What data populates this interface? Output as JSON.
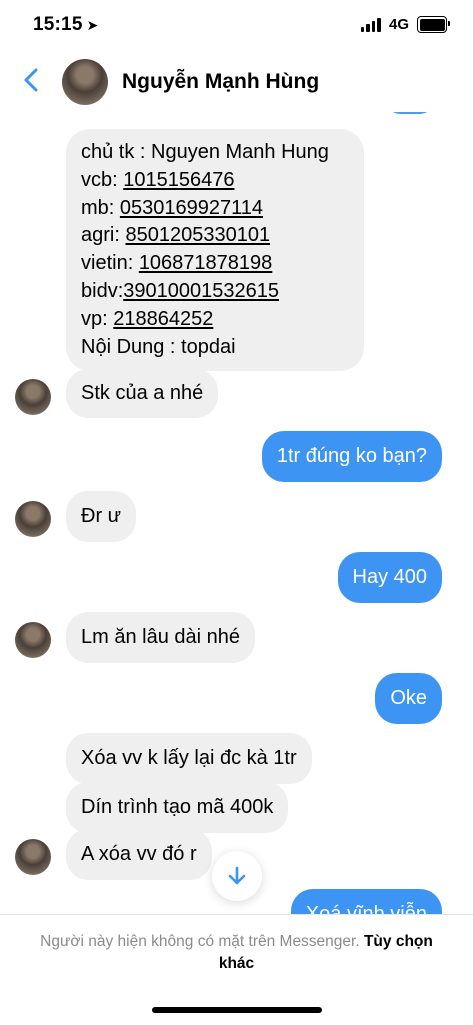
{
  "status": {
    "time": "15:15",
    "network": "4G"
  },
  "header": {
    "contact_name": "Nguyễn Mạnh Hùng"
  },
  "messages": {
    "account_info": [
      {
        "label": "chủ tk : Nguyen Manh Hung",
        "link": ""
      },
      {
        "label": "vcb: ",
        "link": "1015156476"
      },
      {
        "label": "mb: ",
        "link": "0530169927114"
      },
      {
        "label": "agri: ",
        "link": "8501205330101"
      },
      {
        "label": "vietin: ",
        "link": "106871878198"
      },
      {
        "label": "bidv:",
        "link": "39010001532615"
      },
      {
        "label": "vp: ",
        "link": "218864252"
      },
      {
        "label": "Nội Dung : topdai",
        "link": ""
      }
    ],
    "m1": "Stk của a nhé",
    "m2": "1tr đúng ko bạn?",
    "m3": "Đr ư",
    "m4": "Hay 400",
    "m5": "Lm ăn lâu dài nhé",
    "m6": "Oke",
    "m7": "Xóa vv k lấy lại đc kà 1tr",
    "m8": "Dín trình tạo mã 400k",
    "m9": "A xóa vv đó r",
    "m10": "Xoá vĩnh viễn"
  },
  "footer": {
    "notice": "Người này hiện không có mặt trên Messenger.",
    "options_link": "Tùy chọn khác"
  },
  "colors": {
    "accent": "#3d94f3",
    "incoming_bubble": "#efefef"
  }
}
